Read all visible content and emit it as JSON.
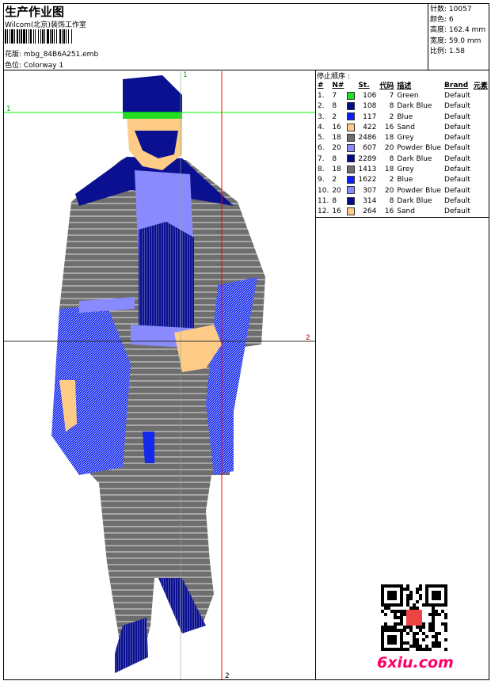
{
  "header": {
    "title": "生产作业图",
    "company": "Wilcom(北京)装饰工作室",
    "design": "花版: mbg_84B6A251.emb",
    "colorway": "色位: Colorway 1"
  },
  "stats": [
    {
      "label": "针数",
      "value": "10057"
    },
    {
      "label": "颜色",
      "value": "6"
    },
    {
      "label": "高度",
      "value": "162.4 mm"
    },
    {
      "label": "宽度",
      "value": "59.0 mm"
    },
    {
      "label": "比例",
      "value": "1.58"
    }
  ],
  "stops": {
    "title": "停止顺序 :",
    "headers": [
      "#",
      "N#",
      "",
      "St.",
      "代码",
      "描述",
      "Brand",
      "元素"
    ],
    "rows": [
      {
        "idx": "1.",
        "n": "7",
        "color": "#22dd22",
        "st": "106",
        "code": "7",
        "desc": "Green",
        "brand": "Default"
      },
      {
        "idx": "2.",
        "n": "8",
        "color": "#000a8c",
        "st": "108",
        "code": "8",
        "desc": "Dark Blue",
        "brand": "Default"
      },
      {
        "idx": "3.",
        "n": "2",
        "color": "#0a1eff",
        "st": "117",
        "code": "2",
        "desc": "Blue",
        "brand": "Default"
      },
      {
        "idx": "4.",
        "n": "16",
        "color": "#ffcc88",
        "st": "422",
        "code": "16",
        "desc": "Sand",
        "brand": "Default"
      },
      {
        "idx": "5.",
        "n": "18",
        "color": "#6e6e6e",
        "st": "2486",
        "code": "18",
        "desc": "Grey",
        "brand": "Default"
      },
      {
        "idx": "6.",
        "n": "20",
        "color": "#8a8aff",
        "st": "607",
        "code": "20",
        "desc": "Powder Blue",
        "brand": "Default"
      },
      {
        "idx": "7.",
        "n": "8",
        "color": "#000a8c",
        "st": "2289",
        "code": "8",
        "desc": "Dark Blue",
        "brand": "Default"
      },
      {
        "idx": "8.",
        "n": "18",
        "color": "#6e6e6e",
        "st": "1413",
        "code": "18",
        "desc": "Grey",
        "brand": "Default"
      },
      {
        "idx": "9.",
        "n": "2",
        "color": "#0a1eff",
        "st": "1622",
        "code": "2",
        "desc": "Blue",
        "brand": "Default"
      },
      {
        "idx": "10.",
        "n": "20",
        "color": "#8a8aff",
        "st": "307",
        "code": "20",
        "desc": "Powder Blue",
        "brand": "Default"
      },
      {
        "idx": "11.",
        "n": "8",
        "color": "#000a8c",
        "st": "314",
        "code": "8",
        "desc": "Dark Blue",
        "brand": "Default"
      },
      {
        "idx": "12.",
        "n": "16",
        "color": "#ffcc88",
        "st": "264",
        "code": "16",
        "desc": "Sand",
        "brand": "Default"
      }
    ]
  },
  "guides": {
    "h1": "1",
    "v1": "1",
    "h2": "2",
    "v2": "2"
  },
  "watermark": "6xiu.com"
}
